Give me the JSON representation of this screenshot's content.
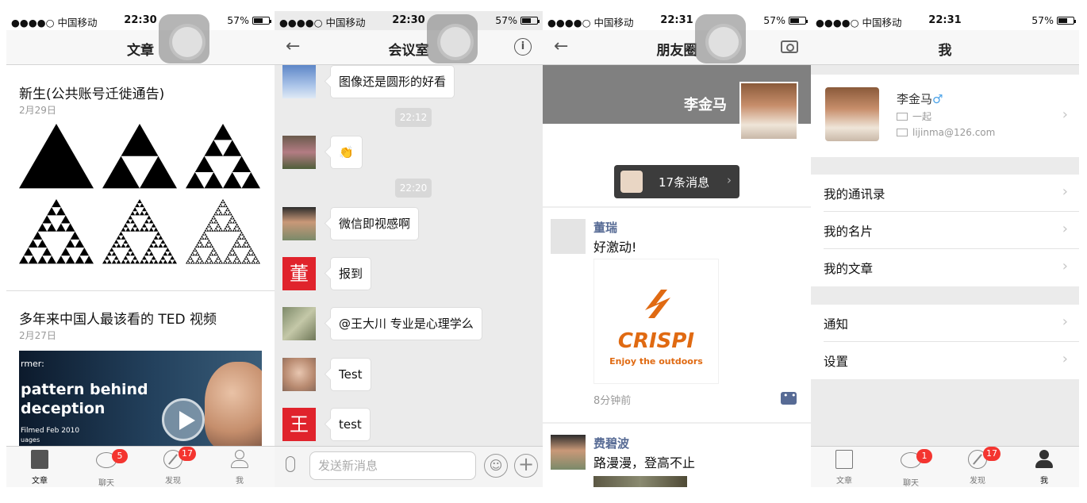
{
  "status": {
    "carrier": "●●●●○ 中国移动",
    "times": [
      "22:30",
      "22:30",
      "22:31",
      "22:31"
    ],
    "battery_percent": "57%",
    "battery_level": 0.57
  },
  "screen1": {
    "title": "文章",
    "articles": [
      {
        "title": "新生(公共账号迁徙通告)",
        "date": "2月29日"
      },
      {
        "title": "多年来中国人最该看的 TED 视频",
        "date": "2月27日"
      }
    ],
    "video_caption": [
      "rmer:",
      "pattern behind",
      "deception",
      "Filmed Feb 2010",
      "uages"
    ]
  },
  "screen2": {
    "title": "会议室",
    "messages": [
      {
        "text": "图像还是圆形的好看",
        "avatar": "sky-photo"
      },
      {
        "time": "22:12"
      },
      {
        "text": "👏",
        "avatar": "woman-photo"
      },
      {
        "time": "22:20"
      },
      {
        "text": "微信即视感啊",
        "avatar": "man-photo"
      },
      {
        "text": "报到",
        "avatar_char": "董"
      },
      {
        "text": "@王大川 专业是心理学么",
        "avatar": "banknote-photo"
      },
      {
        "text": "Test",
        "avatar": "woman-face-photo"
      },
      {
        "text": "test",
        "avatar_char": "王"
      }
    ],
    "input_placeholder": "发送新消息"
  },
  "screen3": {
    "title": "朋友圈",
    "cover_name": "李金马",
    "notify": "17条消息",
    "posts": [
      {
        "name": "董瑞",
        "text": "好激动!",
        "brand": "CRISPI",
        "tagline": "Enjoy the outdoors",
        "time": "8分钟前"
      },
      {
        "name": "费碧波",
        "text": "路漫漫，登高不止"
      }
    ]
  },
  "screen4": {
    "title": "我",
    "profile": {
      "name": "李金马",
      "gender": "♂",
      "org": "一起",
      "email": "lijinma@126.com"
    },
    "rows_group1": [
      "我的通讯录",
      "我的名片",
      "我的文章"
    ],
    "rows_group2": [
      "通知",
      "设置"
    ]
  },
  "tabs": [
    {
      "label": "文章",
      "icon": "article-icon"
    },
    {
      "label": "聊天",
      "icon": "chat-icon"
    },
    {
      "label": "发现",
      "icon": "discover-icon"
    },
    {
      "label": "我",
      "icon": "me-icon"
    }
  ],
  "badges": {
    "screen1": {
      "chat": "5",
      "discover": "17"
    },
    "screen4": {
      "chat": "1",
      "discover": "17"
    }
  },
  "colors": {
    "badge": "#f43530",
    "link_name": "#576b95",
    "brand_orange": "#e06a12"
  }
}
